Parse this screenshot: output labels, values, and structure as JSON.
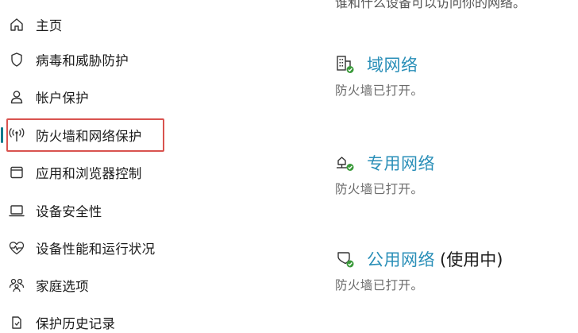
{
  "sidebar": {
    "items": [
      {
        "label": "主页",
        "icon": "home-icon"
      },
      {
        "label": "病毒和威胁防护",
        "icon": "shield-icon"
      },
      {
        "label": "帐户保护",
        "icon": "person-icon"
      },
      {
        "label": "防火墙和网络保护",
        "icon": "antenna-icon",
        "selected": true
      },
      {
        "label": "应用和浏览器控制",
        "icon": "app-window-icon"
      },
      {
        "label": "设备安全性",
        "icon": "laptop-icon"
      },
      {
        "label": "设备性能和运行状况",
        "icon": "heart-pulse-icon"
      },
      {
        "label": "家庭选项",
        "icon": "family-icon"
      },
      {
        "label": "保护历史记录",
        "icon": "history-icon"
      }
    ]
  },
  "main": {
    "top_cut_text": "谁和什么设备可以访问你的网络。",
    "networks": [
      {
        "title": "域网络",
        "suffix": "",
        "status": "防火墙已打开。",
        "icon": "domain-network-icon"
      },
      {
        "title": "专用网络",
        "suffix": "",
        "status": "防火墙已打开。",
        "icon": "private-network-icon"
      },
      {
        "title": "公用网络",
        "suffix": "(使用中)",
        "status": "防火墙已打开。",
        "icon": "public-network-icon"
      }
    ]
  },
  "colors": {
    "accent": "#0f7a8c",
    "link": "#2a8fb8",
    "highlight": "#d9534f",
    "ok_green": "#3a9a3a"
  }
}
